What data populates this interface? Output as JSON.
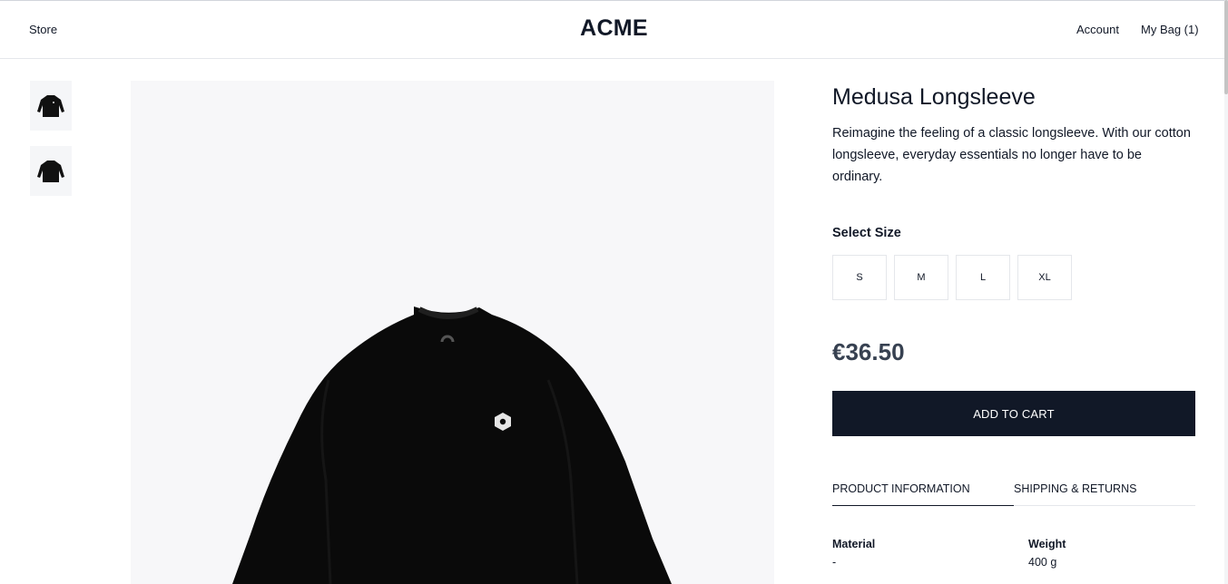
{
  "header": {
    "store_label": "Store",
    "logo": "ACME",
    "account_label": "Account",
    "bag_label": "My Bag (1)"
  },
  "gallery": {
    "thumbnails": [
      "longsleeve-front-thumbnail",
      "longsleeve-back-thumbnail"
    ],
    "main_image": "black-longsleeve-product-photo"
  },
  "product": {
    "title": "Medusa Longsleeve",
    "description": "Reimagine the feeling of a classic longsleeve. With our cotton longsleeve, everyday essentials no longer have to be ordinary.",
    "size_label": "Select Size",
    "sizes": [
      "S",
      "M",
      "L",
      "XL"
    ],
    "price": "€36.50",
    "add_to_cart": "ADD TO CART"
  },
  "tabs": [
    {
      "label": "PRODUCT INFORMATION",
      "active": true
    },
    {
      "label": "SHIPPING & RETURNS",
      "active": false
    }
  ],
  "specs": [
    {
      "key": "Material",
      "value": "-"
    },
    {
      "key": "Weight",
      "value": "400 g"
    }
  ],
  "colors": {
    "primary": "#111827",
    "price": "#374151",
    "image_bg": "#f7f7f9"
  }
}
